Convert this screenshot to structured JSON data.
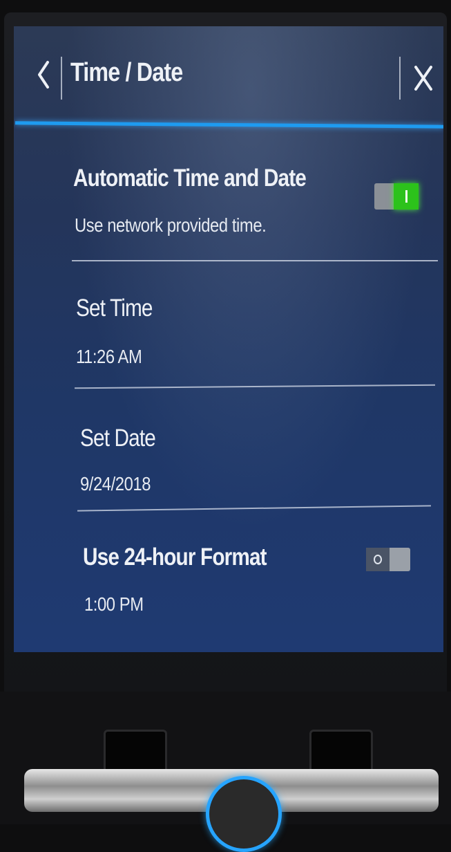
{
  "header": {
    "back_icon": "chevron-left-icon",
    "title": "Time / Date",
    "close_icon": "close-icon",
    "accent_color": "#1e9bf0"
  },
  "settings": {
    "automatic": {
      "title": "Automatic Time and Date",
      "subtitle": "Use network provided time.",
      "toggle_on": true,
      "toggle_color": "#2cc21b"
    },
    "set_time": {
      "title": "Set Time",
      "value": "11:26 AM"
    },
    "set_date": {
      "title": "Set Date",
      "value": "9/24/2018"
    },
    "format_24h": {
      "title": "Use 24-hour Format",
      "subtitle": "1:00 PM",
      "toggle_on": false
    }
  }
}
